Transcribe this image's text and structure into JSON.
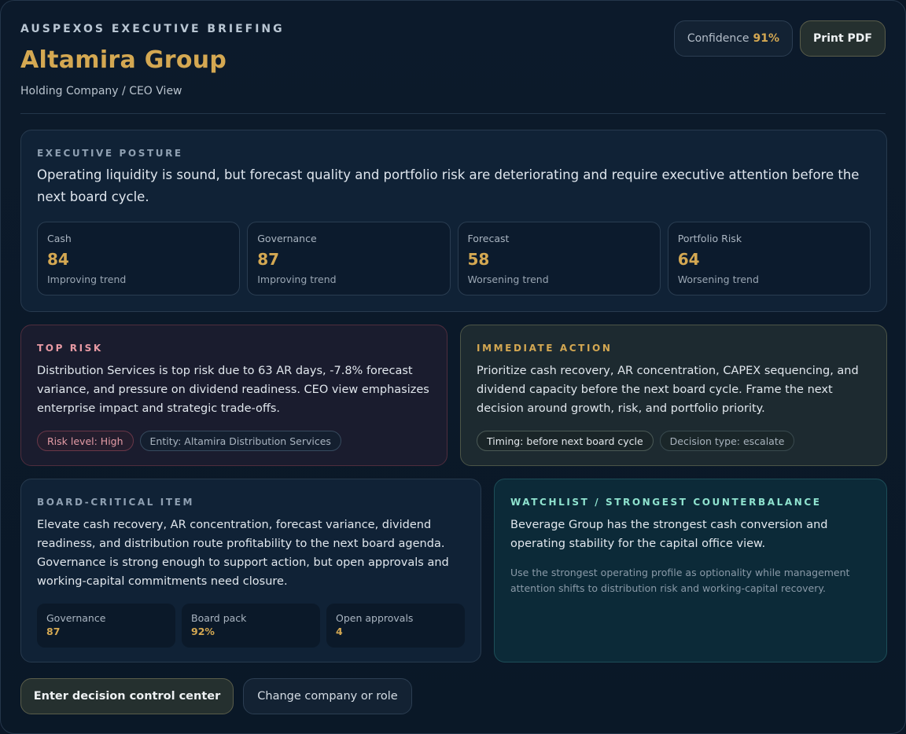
{
  "header": {
    "eyebrow": "AUSPEXOS EXECUTIVE BRIEFING",
    "company": "Altamira Group",
    "subtitle": "Holding Company / CEO View",
    "confidence_label": "Confidence",
    "confidence_value": "91%",
    "print_label": "Print PDF"
  },
  "posture": {
    "label": "EXECUTIVE POSTURE",
    "text": "Operating liquidity is sound, but forecast quality and portfolio risk are deteriorating and require executive attention before the next board cycle.",
    "metrics": [
      {
        "label": "Cash",
        "value": "84",
        "trend": "Improving trend"
      },
      {
        "label": "Governance",
        "value": "87",
        "trend": "Improving trend"
      },
      {
        "label": "Forecast",
        "value": "58",
        "trend": "Worsening trend"
      },
      {
        "label": "Portfolio Risk",
        "value": "64",
        "trend": "Worsening trend"
      }
    ]
  },
  "risk": {
    "label": "TOP RISK",
    "text": "Distribution Services is top risk due to 63 AR days, -7.8% forecast variance, and pressure on dividend readiness. CEO view emphasizes enterprise impact and strategic trade-offs.",
    "tags": [
      "Risk level: High",
      "Entity: Altamira Distribution Services"
    ]
  },
  "action": {
    "label": "IMMEDIATE ACTION",
    "text": "Prioritize cash recovery, AR concentration, CAPEX sequencing, and dividend capacity before the next board cycle. Frame the next decision around growth, risk, and portfolio priority.",
    "tags": [
      "Timing: before next board cycle",
      "Decision type: escalate"
    ]
  },
  "board": {
    "label": "BOARD-CRITICAL ITEM",
    "text": "Elevate cash recovery, AR concentration, forecast variance, dividend readiness, and distribution route profitability to the next board agenda. Governance is strong enough to support action, but open approvals and working-capital commitments need closure.",
    "stats": [
      {
        "label": "Governance",
        "value": "87"
      },
      {
        "label": "Board pack",
        "value": "92%"
      },
      {
        "label": "Open approvals",
        "value": "4"
      }
    ]
  },
  "watch": {
    "label": "WATCHLIST / STRONGEST COUNTERBALANCE",
    "text": "Beverage Group has the strongest cash conversion and operating stability for the capital office view.",
    "note": "Use the strongest operating profile as optionality while management attention shifts to distribution risk and working-capital recovery."
  },
  "footer": {
    "enter_label": "Enter decision control center",
    "change_label": "Change company or role"
  },
  "colors": {
    "accent_gold": "#d4a852",
    "risk_pink": "#e89aa4",
    "watch_teal": "#8fe3cf",
    "background": "#0a1626"
  }
}
